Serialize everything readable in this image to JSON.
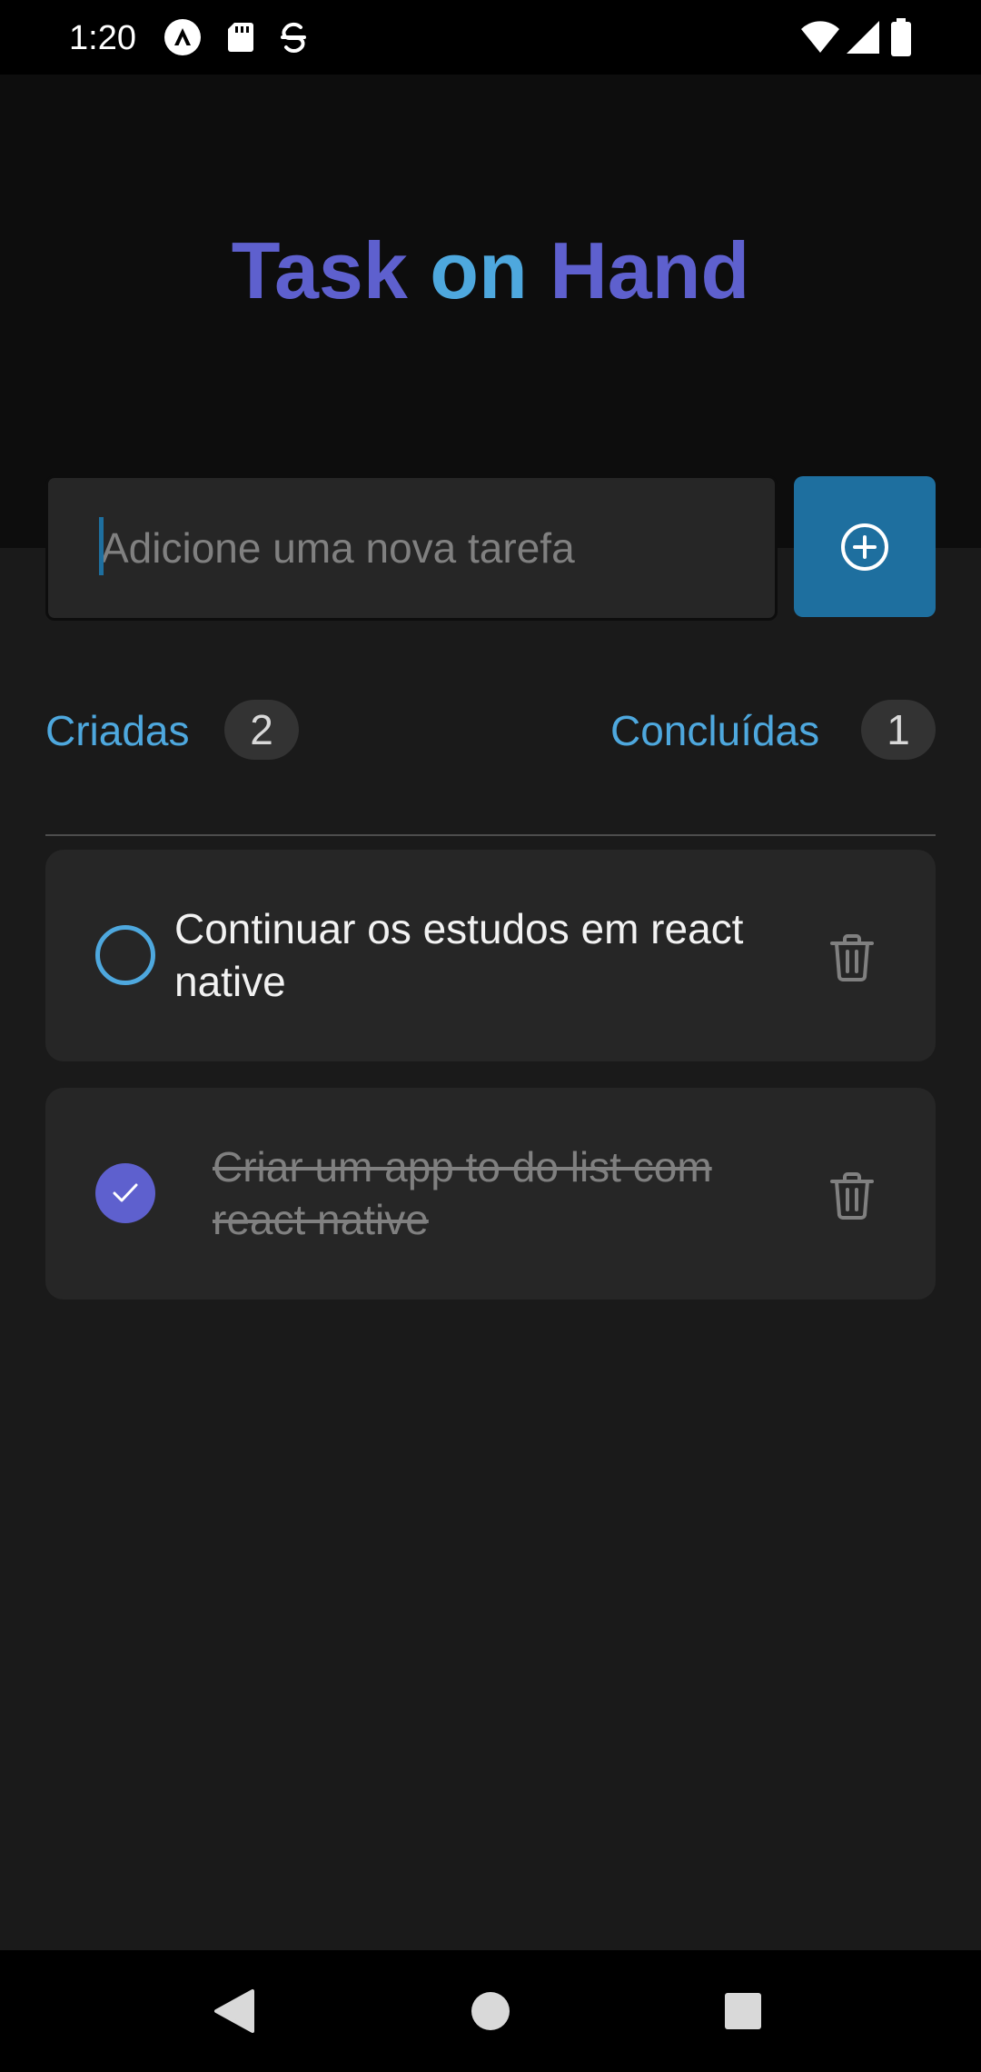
{
  "status_bar": {
    "time": "1:20",
    "left_icons": [
      "app-a-icon",
      "sd-card-icon",
      "sync-app-icon"
    ],
    "right_icons": [
      "wifi-icon",
      "cell-signal-icon",
      "battery-icon"
    ]
  },
  "header": {
    "title_parts": [
      "Task",
      "on",
      "Hand"
    ],
    "colors": {
      "purple": "#5e60ce",
      "blue": "#4ea8de",
      "header_bg": "#0d0d0d"
    }
  },
  "new_task": {
    "placeholder": "Adicione uma nova tarefa",
    "value": "",
    "add_icon": "plus-circle-icon",
    "button_color": "#1e6f9f"
  },
  "counters": {
    "created_label": "Criadas",
    "created_count": "2",
    "done_label": "Concluídas",
    "done_count": "1"
  },
  "tasks": [
    {
      "text": "Continuar os estudos em react native",
      "done": false,
      "check_icon": "empty-circle-icon",
      "delete_icon": "trash-icon"
    },
    {
      "text": "Criar um app to do list com react native",
      "done": true,
      "check_icon": "check-circle-icon",
      "delete_icon": "trash-icon"
    }
  ],
  "nav_bar": {
    "buttons": [
      "back-triangle-icon",
      "home-circle-icon",
      "recents-square-icon"
    ]
  }
}
